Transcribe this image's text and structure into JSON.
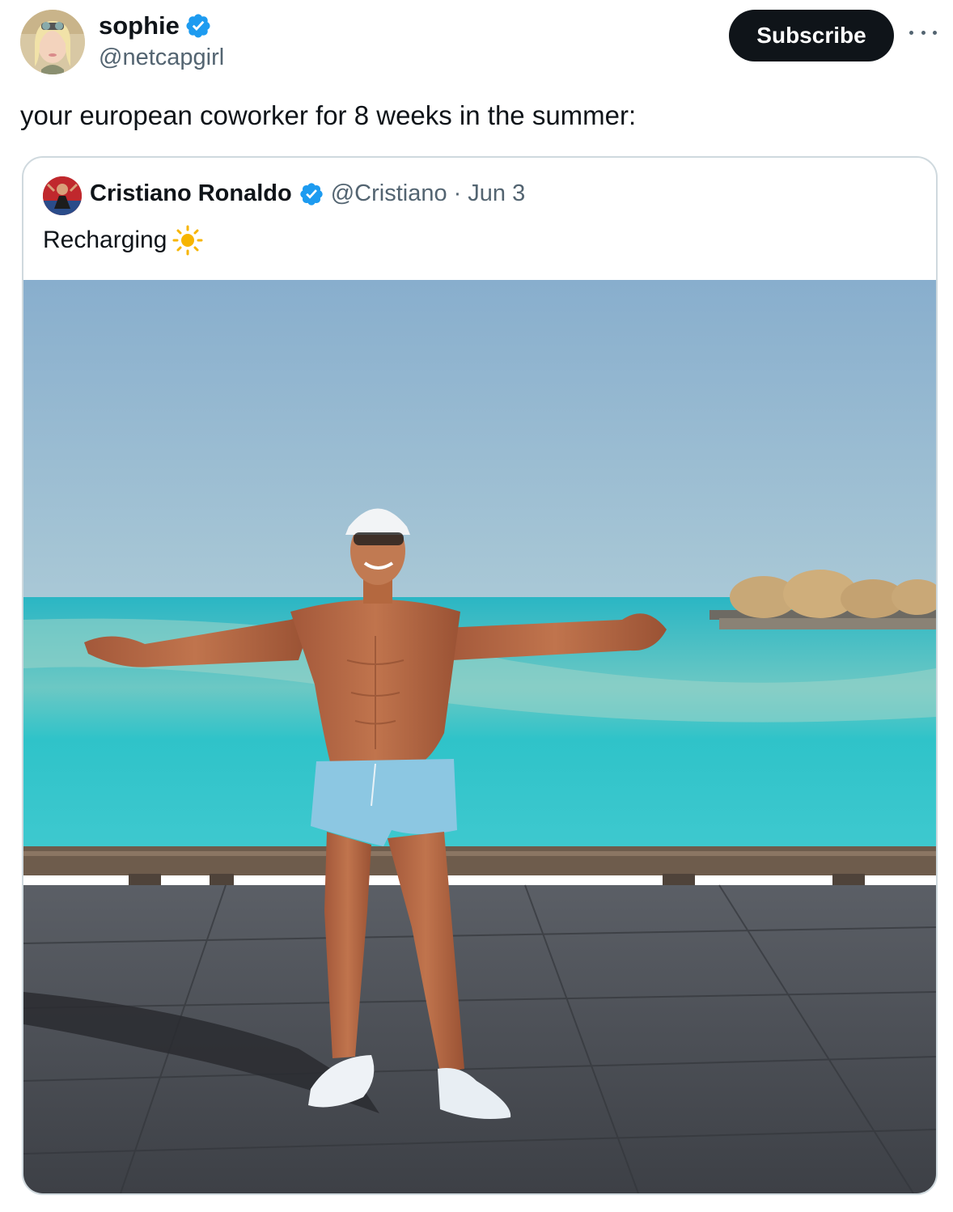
{
  "author": {
    "display_name": "sophie",
    "handle": "@netcapgirl",
    "avatar_icon": "user-avatar",
    "verified": true
  },
  "subscribe_label": "Subscribe",
  "more_icon": "ellipsis-icon",
  "tweet_text": "your european coworker for 8 weeks in the summer:",
  "quote": {
    "display_name": "Cristiano Ronaldo",
    "handle": "@Cristiano",
    "separator": "·",
    "date": "Jun 3",
    "text": "Recharging",
    "emoji_icon": "sun-emoji",
    "image_description": "man-on-boardwalk-photo"
  },
  "colors": {
    "verified_blue": "#1d9bf0",
    "text_primary": "#0f1419",
    "text_secondary": "#536471",
    "border": "#cfd9de",
    "button_bg": "#0f1419"
  }
}
